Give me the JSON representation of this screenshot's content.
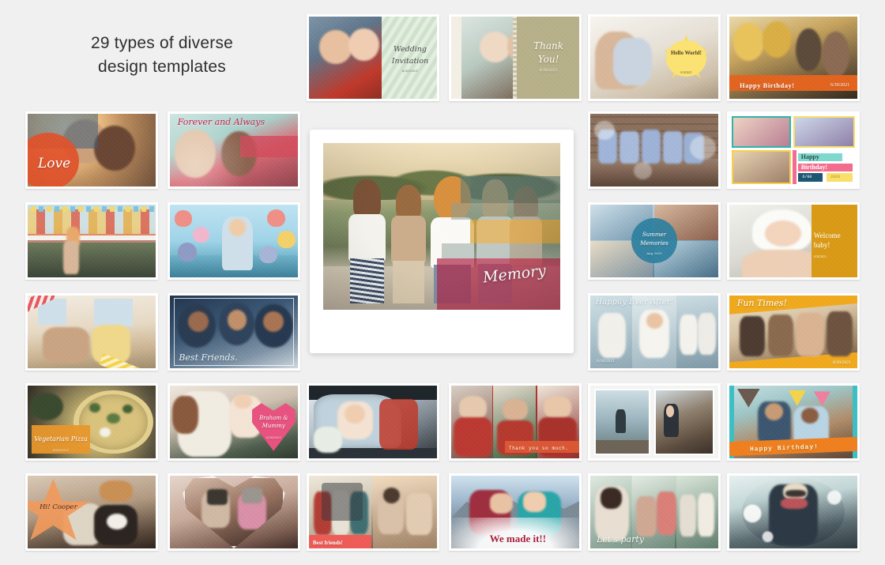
{
  "page": {
    "background_color": "#f0f0f0",
    "headline_line1": "29 types of diverse",
    "headline_line2": "design templates",
    "template_count": 29
  },
  "featured": {
    "name": "memory-polaroid",
    "label": "Memory",
    "style": "polaroid frame with rainbow color bands",
    "accent_colors": [
      "#5f7d78",
      "#d9a441",
      "#b02a4a",
      "#8c9e98"
    ]
  },
  "templates": [
    {
      "id": "wedding-invitation",
      "label": "Wedding Invitation",
      "sublabel": "6/30/2021",
      "accent": "#dce8da",
      "row": 1,
      "col": 3
    },
    {
      "id": "thank-you",
      "label": "Thank You!",
      "sublabel": "6/30/2021",
      "accent": "#b7b089",
      "row": 1,
      "col": 4
    },
    {
      "id": "hello-world",
      "label": "Hello World!",
      "sublabel": "6/30/2021",
      "accent": "#f7d94e",
      "row": 1,
      "col": 5
    },
    {
      "id": "happy-birthday-40",
      "label": "Happy Birthday!",
      "sublabel": "6/30/2021",
      "accent": "#e2641f",
      "row": 1,
      "col": 6
    },
    {
      "id": "love",
      "label": "Love",
      "sublabel": "",
      "accent": "#e0512a",
      "row": 2,
      "col": 1
    },
    {
      "id": "forever-and-always",
      "label": "Forever and Always",
      "sublabel": "",
      "accent": "#c8234f",
      "row": 2,
      "col": 2
    },
    {
      "id": "kids-bokeh",
      "label": "",
      "sublabel": "",
      "accent": "#9aa3ab",
      "row": 2,
      "col": 5
    },
    {
      "id": "happy-birthday-collage",
      "label": "Happy Birthday!",
      "sublabel": "6/00  2020",
      "accent": "#f26d8e",
      "row": 2,
      "col": 6
    },
    {
      "id": "harbor-icecream",
      "label": "",
      "sublabel": "",
      "accent": "#e8c75a",
      "row": 3,
      "col": 1
    },
    {
      "id": "balloons-kid",
      "label": "",
      "sublabel": "",
      "accent": "#8fd0e6",
      "row": 3,
      "col": 2
    },
    {
      "id": "summer-memories",
      "label": "Summer Memories",
      "sublabel": "Aug 2020",
      "accent": "#2d7fa0",
      "row": 3,
      "col": 5
    },
    {
      "id": "welcome-baby",
      "label": "Welcome baby!",
      "sublabel": "6/30/2021",
      "accent": "#d99a17",
      "row": 3,
      "col": 6
    },
    {
      "id": "washi-dog-girl",
      "label": "",
      "sublabel": "",
      "accent": "#e4595f",
      "row": 4,
      "col": 1
    },
    {
      "id": "best-friends-trio",
      "label": "Best Friends.",
      "sublabel": "",
      "accent": "#1d3f63",
      "row": 4,
      "col": 2
    },
    {
      "id": "happily-ever-after",
      "label": "Happily Ever After!",
      "sublabel": "6/30/2021",
      "accent": "#b7c6cf",
      "row": 4,
      "col": 5
    },
    {
      "id": "fun-times",
      "label": "Fun Times!",
      "sublabel": "6/30/2021",
      "accent": "#f0a91e",
      "row": 4,
      "col": 6
    },
    {
      "id": "vegetarian-pizza",
      "label": "Vegetarian Pizza",
      "sublabel": "6/30/2021",
      "accent": "#e8972c",
      "row": 5,
      "col": 1
    },
    {
      "id": "braham-and-mummy",
      "label": "Braham & Mummy",
      "sublabel": "6/30/2021",
      "accent": "#e8527f",
      "row": 5,
      "col": 2
    },
    {
      "id": "bride-in-car",
      "label": "",
      "sublabel": "",
      "accent": "#c9ccd1",
      "row": 5,
      "col": 3
    },
    {
      "id": "thank-you-so-much",
      "label": "Thank you so much.",
      "sublabel": "",
      "accent": "#e05a35",
      "row": 5,
      "col": 4
    },
    {
      "id": "coastal-diptych",
      "label": "",
      "sublabel": "",
      "accent": "#a9bcc4",
      "row": 5,
      "col": 5
    },
    {
      "id": "happy-birthday-party",
      "label": "Happy Birthday!",
      "sublabel": "",
      "accent": "#ef7f1f",
      "row": 5,
      "col": 6
    },
    {
      "id": "hi-cooper",
      "label": "Hi! Cooper",
      "sublabel": "",
      "accent": "#f09a5c",
      "row": 6,
      "col": 1
    },
    {
      "id": "heart-frame-vr",
      "label": "",
      "sublabel": "",
      "accent": "#e7cfc6",
      "row": 6,
      "col": 2
    },
    {
      "id": "best-friends-van",
      "label": "Best friends!",
      "sublabel": "",
      "accent": "#ef5c57",
      "row": 6,
      "col": 3
    },
    {
      "id": "we-made-it",
      "label": "We made it!!",
      "sublabel": "",
      "accent": "#a81f3c",
      "row": 6,
      "col": 4
    },
    {
      "id": "lets-party",
      "label": "Let's party",
      "sublabel": "",
      "accent": "#8fb5ad",
      "row": 6,
      "col": 5
    },
    {
      "id": "snow-winter",
      "label": "",
      "sublabel": "",
      "accent": "#6f8b90",
      "row": 6,
      "col": 6
    }
  ]
}
